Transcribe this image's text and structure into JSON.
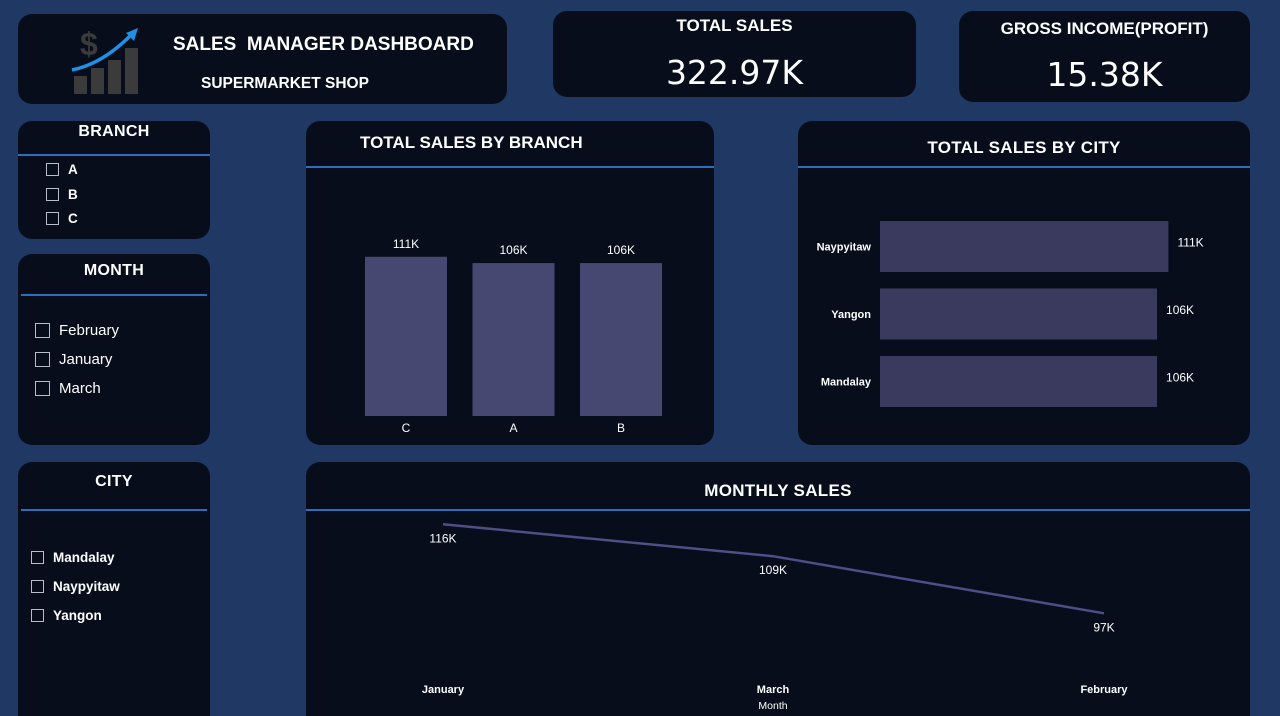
{
  "header": {
    "title": "SALES  MANAGER DASHBOARD",
    "subtitle": "SUPERMARKET SHOP",
    "logo_icon": "dollar-growth-chart-icon"
  },
  "kpis": {
    "total_sales": {
      "label": "TOTAL SALES",
      "value": "322.97K"
    },
    "gross_income": {
      "label": "GROSS INCOME(PROFIT)",
      "value": "15.38K"
    }
  },
  "filters": {
    "branch": {
      "title": "BRANCH",
      "options": [
        "A",
        "B",
        "C"
      ]
    },
    "month": {
      "title": "MONTH",
      "options": [
        "February",
        "January",
        "March"
      ]
    },
    "city": {
      "title": "CITY",
      "options": [
        "Mandalay",
        "Naypyitaw",
        "Yangon"
      ]
    }
  },
  "colors": {
    "background": "#203864",
    "card": "#080d1c",
    "accent_rule": "#2d6dbd",
    "bar_branch": "#474872",
    "bar_city": "#3a3a5e",
    "line": "#4e4f86"
  },
  "chart_data": [
    {
      "type": "bar",
      "title": "TOTAL SALES BY BRANCH",
      "orientation": "vertical",
      "categories": [
        "C",
        "A",
        "B"
      ],
      "values": [
        110.57,
        106.2,
        106.2
      ],
      "labels": [
        "111K",
        "106K",
        "106K"
      ],
      "ylim": [
        0,
        125
      ],
      "grid": false
    },
    {
      "type": "bar",
      "title": "TOTAL SALES BY CITY",
      "orientation": "horizontal",
      "categories": [
        "Naypyitaw",
        "Yangon",
        "Mandalay"
      ],
      "values": [
        110.57,
        106.2,
        106.2
      ],
      "labels": [
        "111K",
        "106K",
        "106K"
      ],
      "xlim": [
        0,
        115
      ],
      "grid": false
    },
    {
      "type": "line",
      "title": "MONTHLY SALES",
      "x": [
        "January",
        "March",
        "February"
      ],
      "values": [
        116.29,
        109.46,
        97.22
      ],
      "labels": [
        "116K",
        "109K",
        "97K"
      ],
      "xlabel": "Month",
      "ylim": [
        90,
        120
      ],
      "grid": false
    }
  ]
}
